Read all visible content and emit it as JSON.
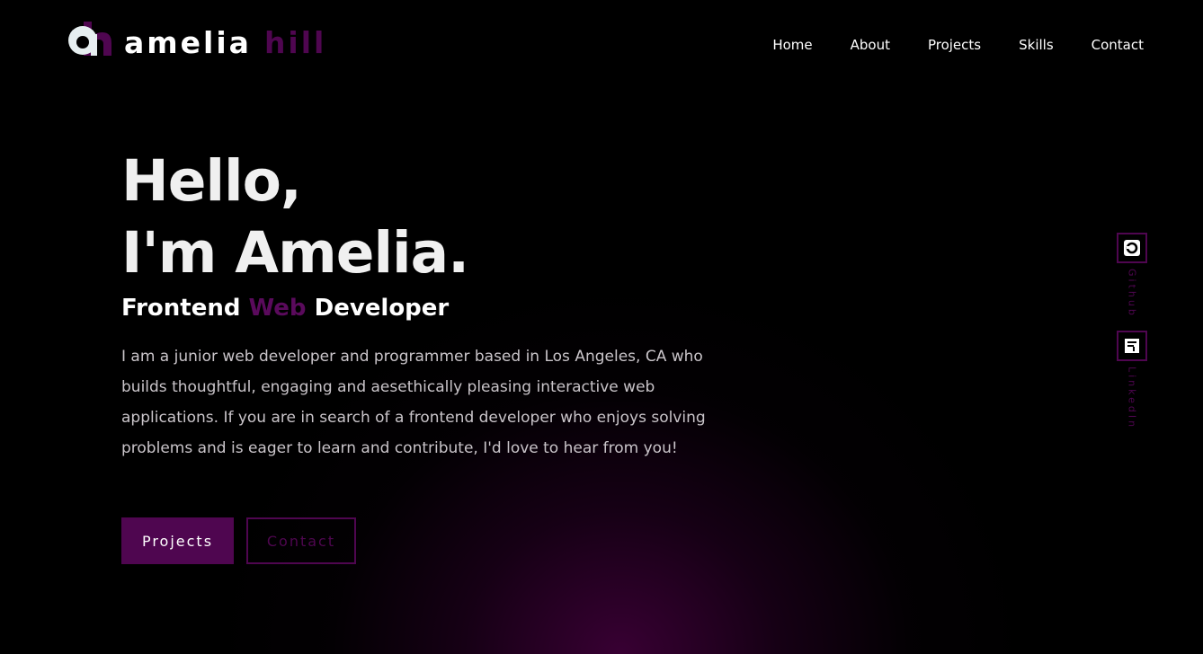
{
  "brand": {
    "first": "amelia",
    "last": "hill",
    "logo_icon": "ah-monogram-icon"
  },
  "nav": {
    "items": [
      {
        "label": "Home"
      },
      {
        "label": "About"
      },
      {
        "label": "Projects"
      },
      {
        "label": "Skills"
      },
      {
        "label": "Contact"
      }
    ]
  },
  "hero": {
    "greeting_line1": "Hello,",
    "greeting_line2": "I'm Amelia.",
    "subtitle_pre": "Frontend",
    "subtitle_accent": "Web",
    "subtitle_post": "Developer",
    "description": "I am a junior web developer and programmer based in Los Angeles, CA who builds thoughtful, engaging and aesethically pleasing interactive web applications. If you are in search of a frontend developer who enjoys solving problems and is eager to learn and contribute, I'd love to hear from you!"
  },
  "buttons": {
    "primary_label": "Projects",
    "secondary_label": "Contact"
  },
  "social": {
    "items": [
      {
        "label": "Github",
        "icon": "github-icon"
      },
      {
        "label": "LinkedIn",
        "icon": "linkedin-icon"
      }
    ]
  },
  "colors": {
    "background": "#000000",
    "accent": "#4f0650",
    "text": "#ffffff",
    "muted_text": "#c9c4c9"
  }
}
